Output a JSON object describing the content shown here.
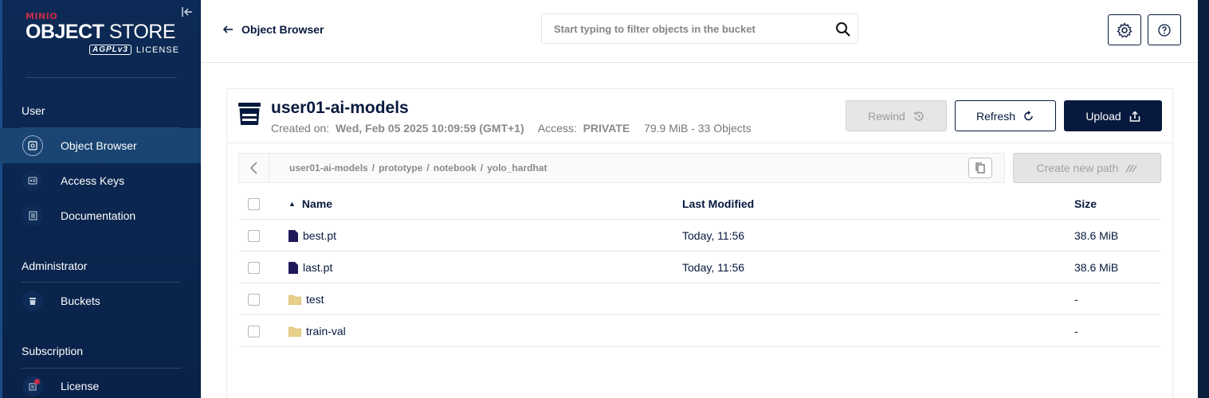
{
  "sidebar": {
    "logo": {
      "brand": "MINIO",
      "title_bold": "OBJECT",
      "title_rest": " STORE",
      "badge": "AGPLv3",
      "license": "LICENSE"
    },
    "sections": [
      {
        "title": "User"
      },
      {
        "title": "Administrator"
      },
      {
        "title": "Subscription"
      }
    ],
    "items": [
      {
        "label": "Object Browser",
        "icon": "object-browser-icon",
        "active": true
      },
      {
        "label": "Access Keys",
        "icon": "key-icon"
      },
      {
        "label": "Documentation",
        "icon": "document-icon"
      },
      {
        "label": "Buckets",
        "icon": "bucket-icon"
      },
      {
        "label": "License",
        "icon": "license-icon"
      }
    ]
  },
  "header": {
    "back_label": "Object Browser",
    "search_placeholder": "Start typing to filter objects in the bucket"
  },
  "bucket": {
    "name": "user01-ai-models",
    "created_label": "Created on:",
    "created_value": "Wed, Feb 05 2025 10:09:59 (GMT+1)",
    "access_label": "Access:",
    "access_value": "PRIVATE",
    "usage": "79.9 MiB - 33 Objects"
  },
  "actions": {
    "rewind": "Rewind",
    "refresh": "Refresh",
    "upload": "Upload",
    "new_path": "Create new path"
  },
  "breadcrumb": [
    "user01-ai-models",
    "prototype",
    "notebook",
    "yolo_hardhat"
  ],
  "table": {
    "columns": {
      "name": "Name",
      "modified": "Last Modified",
      "size": "Size"
    },
    "rows": [
      {
        "name": "best.pt",
        "type": "file",
        "modified": "Today, 11:56",
        "size": "38.6 MiB"
      },
      {
        "name": "last.pt",
        "type": "file",
        "modified": "Today, 11:56",
        "size": "38.6 MiB"
      },
      {
        "name": "test",
        "type": "folder",
        "modified": "",
        "size": "-"
      },
      {
        "name": "train-val",
        "type": "folder",
        "modified": "",
        "size": "-"
      }
    ]
  },
  "colors": {
    "navy": "#07193e",
    "sidebar": "#0c2a55",
    "active": "#1a4472",
    "accent_red": "#c72c48",
    "folder": "#e8d08a",
    "file": "#1e1a5a"
  }
}
